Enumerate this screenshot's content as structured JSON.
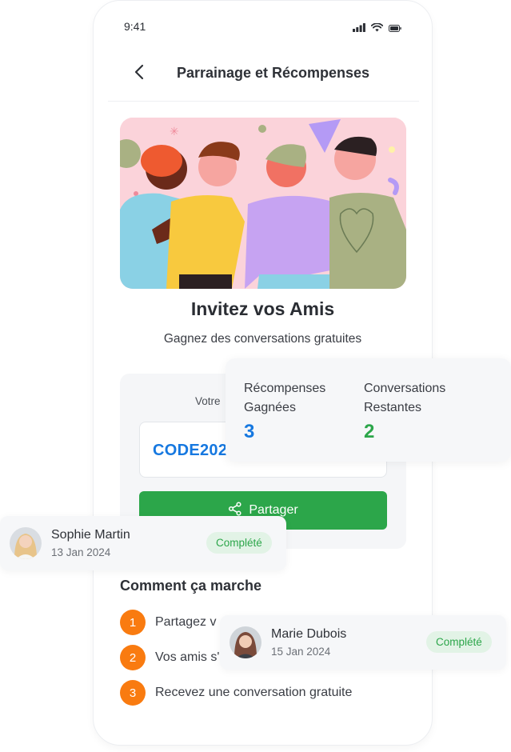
{
  "status_bar": {
    "time": "9:41"
  },
  "header": {
    "title": "Parrainage et Récompenses"
  },
  "hero": {
    "illustration": "friends-group-illustration"
  },
  "intro": {
    "title": "Invitez vos Amis",
    "subtitle": "Gagnez des conversations gratuites"
  },
  "code_card": {
    "label": "Votre",
    "code": "CODE202",
    "share_label": "Partager"
  },
  "how_it_works": {
    "title": "Comment ça marche",
    "steps": [
      {
        "num": "1",
        "text": "Partagez v"
      },
      {
        "num": "2",
        "text": "Vos amis s'"
      },
      {
        "num": "3",
        "text": "Recevez une conversation gratuite"
      }
    ]
  },
  "stats": {
    "rewards": {
      "label": "Récompenses Gagnées",
      "value": "3",
      "color": "#1678e0"
    },
    "remaining": {
      "label": "Conversations Restantes",
      "value": "2",
      "color": "#2ca64a"
    }
  },
  "referrals": [
    {
      "name": "Sophie Martin",
      "date": "13 Jan 2024",
      "status": "Complété"
    },
    {
      "name": "Marie Dubois",
      "date": "15 Jan 2024",
      "status": "Complété"
    }
  ],
  "colors": {
    "primary_green": "#2ca64a",
    "accent_orange": "#f97b10",
    "link_blue": "#1678e0"
  }
}
